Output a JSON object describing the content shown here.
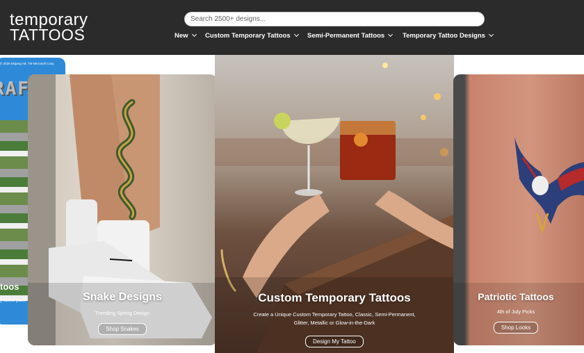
{
  "header": {
    "logo_line1": "temporary",
    "logo_line2": "TATTOOS",
    "search_placeholder": "Search 2500+ designs...",
    "nav": [
      {
        "label": "New"
      },
      {
        "label": "Custom Temporary Tattoos"
      },
      {
        "label": "Semi-Permanent Tattoos"
      },
      {
        "label": "Temporary Tattoo Designs"
      }
    ]
  },
  "cards": {
    "minecraft": {
      "copyright": "© 2026 Mojang AB. TM Microsoft Corp.",
      "logo_text": "RAF",
      "title": "toos",
      "subtitle": "y tattoo pack"
    },
    "snake": {
      "title": "Snake Designs",
      "subtitle": "Trending Spring Design",
      "button": "Shop Snakes"
    },
    "custom": {
      "title": "Custom Temporary Tattoos",
      "subtitle_line1": "Create a Unique Custom Temporary Tattoo, Classic, Semi-Permanent,",
      "subtitle_line2": "Glitter, Metallic or Glow-in-the-Dark",
      "button": "Design My Tattoo"
    },
    "patriotic": {
      "title": "Patriotic Tattoos",
      "subtitle": "4th of July Picks",
      "button": "Shop Looks"
    }
  },
  "colors": {
    "header_bg": "#2b2b2b",
    "minecraft_bg": "#2e8ad8"
  }
}
